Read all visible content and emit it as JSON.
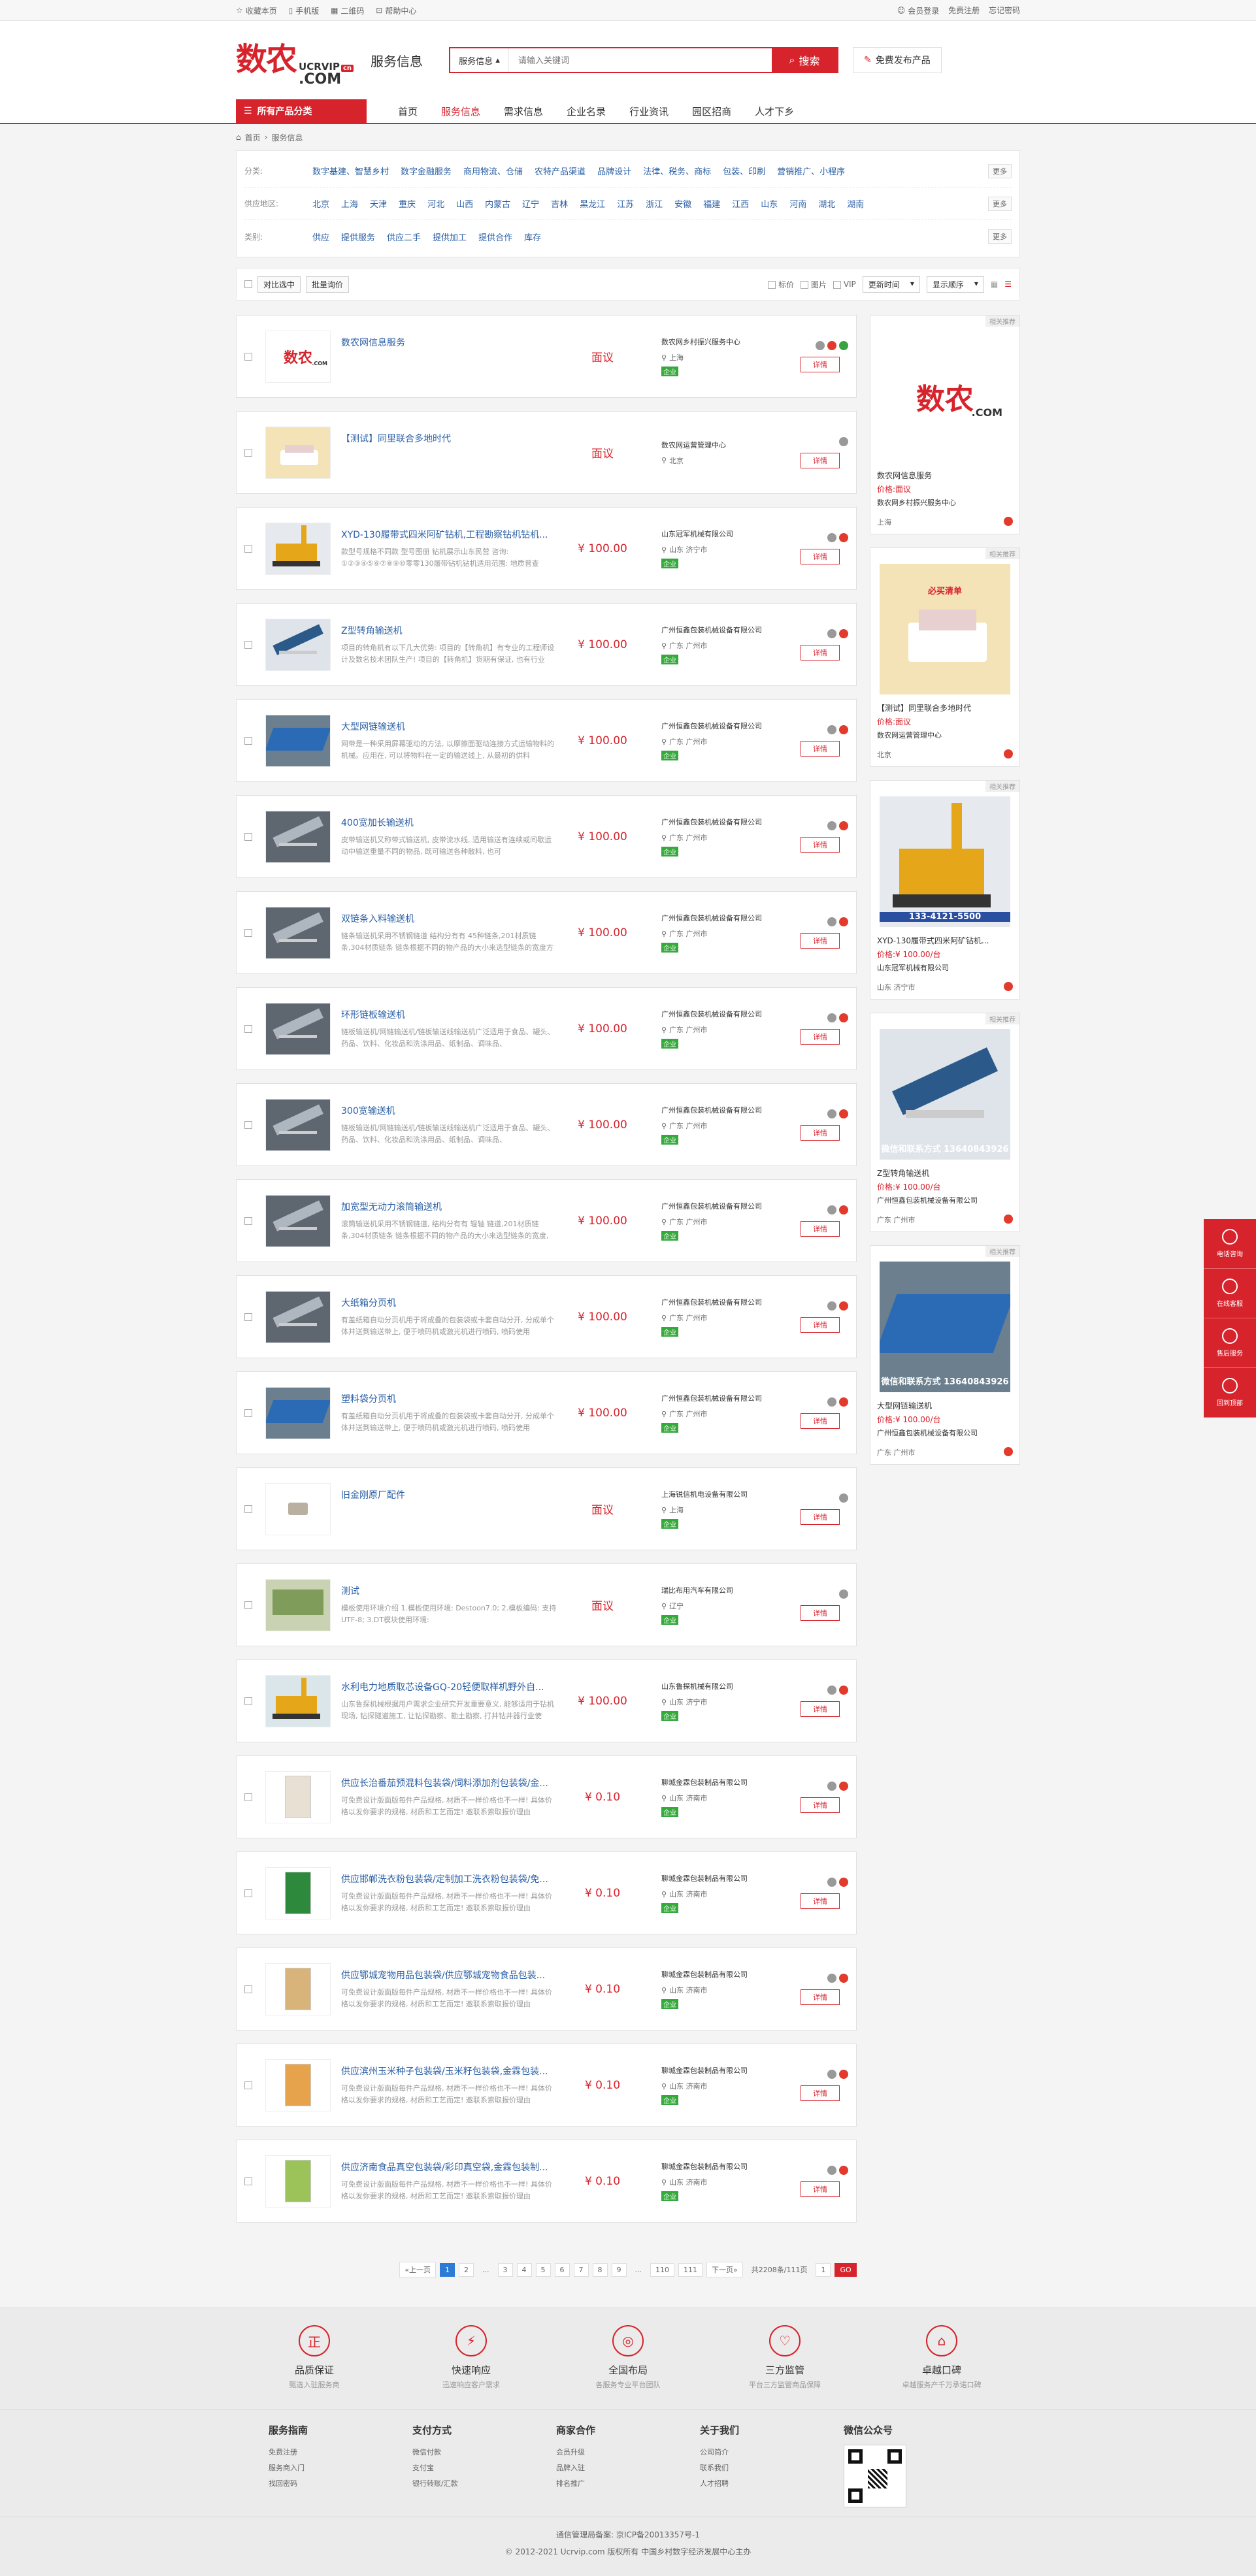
{
  "topbar": {
    "left": [
      "收藏本页",
      "手机版",
      "二维码",
      "帮助中心"
    ],
    "right": [
      "会员登录",
      "免费注册",
      "忘记密码"
    ]
  },
  "header": {
    "logo_cn": "数农",
    "logo_en1": "UCRVIP",
    "logo_en2": ".COM",
    "logo_badge": "cn",
    "title": "服务信息",
    "search_type": "服务信息",
    "search_placeholder": "请输入关键词",
    "search_btn": "搜索",
    "publish_btn": "免费发布产品"
  },
  "nav": {
    "category": "所有产品分类",
    "items": [
      "首页",
      "服务信息",
      "需求信息",
      "企业名录",
      "行业资讯",
      "园区招商",
      "人才下乡"
    ],
    "active": 1
  },
  "breadcrumb": [
    "首页",
    "服务信息"
  ],
  "filters": [
    {
      "label": "分类:",
      "opts": [
        "数字基建、智慧乡村",
        "数字金融服务",
        "商用物流、仓储",
        "农特产品渠道",
        "品牌设计",
        "法律、税务、商标",
        "包装、印刷",
        "营销推广、小程序"
      ],
      "more": "更多"
    },
    {
      "label": "供应地区:",
      "opts": [
        "北京",
        "上海",
        "天津",
        "重庆",
        "河北",
        "山西",
        "内蒙古",
        "辽宁",
        "吉林",
        "黑龙江",
        "江苏",
        "浙江",
        "安徽",
        "福建",
        "江西",
        "山东",
        "河南",
        "湖北",
        "湖南"
      ],
      "more": "更多"
    },
    {
      "label": "类别:",
      "opts": [
        "供应",
        "提供服务",
        "供应二手",
        "提供加工",
        "提供合作",
        "库存"
      ],
      "more": "更多"
    }
  ],
  "toolbar": {
    "compare": "对比选中",
    "inquiry": "批量询价",
    "opt1": "标价",
    "opt2": "图片",
    "opt3": "VIP",
    "sort": "更新时间",
    "display": "显示顺序"
  },
  "items": [
    {
      "title": "数农网信息服务",
      "desc": "",
      "price": "面议",
      "company": "数农网乡村振兴服务中心",
      "loc": "上海",
      "tag": "企业",
      "img": "logo"
    },
    {
      "title": "【测试】同里联合多地时代",
      "desc": "",
      "price": "面议",
      "company": "数农网运营管理中心",
      "loc": "北京",
      "tag": "",
      "img": "bed"
    },
    {
      "title": "XYD-130履带式四米阿矿钻机,工程勘察钻机钻机...",
      "desc": "款型号规格不同款 型号图册 钻机展示山东民营 咨询: ①②③④⑤⑥⑦⑧⑨⑩零零130履带钻机钻机适用范围: 地质普查",
      "price": "¥ 100.00",
      "company": "山东冠军机械有限公司",
      "loc": "山东 济宁市",
      "tag": "企业",
      "img": "drill"
    },
    {
      "title": "Z型转角输送机",
      "desc": "项目的转角机有以下几大优势: 项目的【转角机】有专业的工程师设计及数名技术团队生产! 项目的【转角机】货期有保证, 也有行业",
      "price": "¥ 100.00",
      "company": "广州恒鑫包装机械设备有限公司",
      "loc": "广东 广州市",
      "tag": "企业",
      "img": "conv"
    },
    {
      "title": "大型网链输送机",
      "desc": "网带是一种采用屏幕驱动的方法, 以摩擦面驱动连接方式运输物料的机械。应用在, 可以将物料在一定的输送线上, 从最初的供料",
      "price": "¥ 100.00",
      "company": "广州恒鑫包装机械设备有限公司",
      "loc": "广东 广州市",
      "tag": "企业",
      "img": "blue"
    },
    {
      "title": "400宽加长输送机",
      "desc": "皮带输送机又称带式输送机, 皮带流水线, 适用输送有连续或间歇运动中输送重量不同的物品, 既可输送各种散料, 也可",
      "price": "¥ 100.00",
      "company": "广州恒鑫包装机械设备有限公司",
      "loc": "广东 广州市",
      "tag": "企业",
      "img": "conv2"
    },
    {
      "title": "双链条入料输送机",
      "desc": "链条输送机采用不锈钢链道 结构分有有 45种链条,201材质链条,304材质链条 链条根据不同的物产品的大小来选型链条的宽度方",
      "price": "¥ 100.00",
      "company": "广州恒鑫包装机械设备有限公司",
      "loc": "广东 广州市",
      "tag": "企业",
      "img": "conv3"
    },
    {
      "title": "环形链板输送机",
      "desc": "链板输送机/网链输送机/链板输送线输送机广泛适用于食品、罐头、药品、饮料、化妆品和洗涤用品、纸制品、调味品、",
      "price": "¥ 100.00",
      "company": "广州恒鑫包装机械设备有限公司",
      "loc": "广东 广州市",
      "tag": "企业",
      "img": "conv2"
    },
    {
      "title": "300宽输送机",
      "desc": "链板输送机/网链输送机/链板输送线输送机广泛适用于食品、罐头、药品、饮料、化妆品和洗涤用品、纸制品、调味品、",
      "price": "¥ 100.00",
      "company": "广州恒鑫包装机械设备有限公司",
      "loc": "广东 广州市",
      "tag": "企业",
      "img": "conv3"
    },
    {
      "title": "加宽型无动力滚筒输送机",
      "desc": "滚筒输送机采用不锈钢链道, 结构分有有 辊轴 链道,201材质链条,304材质链条 链条根据不同的物产品的大小来选型链条的宽度, 选型",
      "price": "¥ 100.00",
      "company": "广州恒鑫包装机械设备有限公司",
      "loc": "广东 广州市",
      "tag": "企业",
      "img": "conv2"
    },
    {
      "title": "大纸箱分页机",
      "desc": "有盖纸箱自动分页机用于将成叠的包装袋或卡套自动分开, 分成单个体并送到输送带上, 便于喷码机或激光机进行喷码, 喷码使用",
      "price": "¥ 100.00",
      "company": "广州恒鑫包装机械设备有限公司",
      "loc": "广东 广州市",
      "tag": "企业",
      "img": "conv3"
    },
    {
      "title": "塑料袋分页机",
      "desc": "有盖纸箱自动分页机用于将成叠的包装袋或卡套自动分开, 分成单个体并送到输送带上, 便于喷码机或激光机进行喷码, 喷码使用",
      "price": "¥ 100.00",
      "company": "广州恒鑫包装机械设备有限公司",
      "loc": "广东 广州市",
      "tag": "企业",
      "img": "blue"
    },
    {
      "title": "旧金刚原厂配件",
      "desc": "",
      "price": "面议",
      "company": "上海锐信机电设备有限公司",
      "loc": "上海",
      "tag": "企业",
      "img": "part"
    },
    {
      "title": "测试",
      "desc": "模板使用环境介绍 1.模板使用环境: Destoon7.0; 2.模板编码: 支持UTF-8; 3.DT模块使用环境:",
      "price": "面议",
      "company": "瑞比布用汽车有限公司",
      "loc": "辽宁",
      "tag": "企业",
      "img": "room"
    },
    {
      "title": "水利电力地质取芯设备GQ-20轻便取样机野外自...",
      "desc": "山东鲁探机械根据用户需求企业研究开发重要意义, 能够适用于钻机现场, 钻探隧道施工, 让钻探勘察、勘土勘察, 打井钻井器行业使",
      "price": "¥ 100.00",
      "company": "山东鲁探机械有限公司",
      "loc": "山东 济宁市",
      "tag": "企业",
      "img": "drill2"
    },
    {
      "title": "供应长治番茄预混料包装袋/饲料添加剂包装袋/金...",
      "desc": "可免费设计版面版每件产品规格, 材质不一样价格也不一样! 具体价格以发你要求的规格, 材质和工艺而定! 邀联系索取报价理由",
      "price": "¥ 0.10",
      "company": "聊城金霖包装制品有限公司",
      "loc": "山东 济南市",
      "tag": "企业",
      "img": "bag"
    },
    {
      "title": "供应邯郸洗衣粉包装袋/定制加工洗衣粉包装袋/免...",
      "desc": "可免费设计版面版每件产品规格, 材质不一样价格也不一样! 具体价格以发你要求的规格, 材质和工艺而定! 邀联系索取报价理由",
      "price": "¥ 0.10",
      "company": "聊城金霖包装制品有限公司",
      "loc": "山东 济南市",
      "tag": "企业",
      "img": "bag2"
    },
    {
      "title": "供应鄂城宠物用品包装袋/供应鄂城宠物食品包装...",
      "desc": "可免费设计版面版每件产品规格, 材质不一样价格也不一样! 具体价格以发你要求的规格, 材质和工艺而定! 邀联系索取报价理由",
      "price": "¥ 0.10",
      "company": "聊城金霖包装制品有限公司",
      "loc": "山东 济南市",
      "tag": "企业",
      "img": "bag3"
    },
    {
      "title": "供应滨州玉米种子包装袋/玉米籽包装袋,金霖包装...",
      "desc": "可免费设计版面版每件产品规格, 材质不一样价格也不一样! 具体价格以发你要求的规格, 材质和工艺而定! 邀联系索取报价理由",
      "price": "¥ 0.10",
      "company": "聊城金霖包装制品有限公司",
      "loc": "山东 济南市",
      "tag": "企业",
      "img": "bag4"
    },
    {
      "title": "供应济南食品真空包装袋/彩印真空袋,金霖包装制...",
      "desc": "可免费设计版面版每件产品规格, 材质不一样价格也不一样! 具体价格以发你要求的规格, 材质和工艺而定! 邀联系索取报价理由",
      "price": "¥ 0.10",
      "company": "聊城金霖包装制品有限公司",
      "loc": "山东 济南市",
      "tag": "企业",
      "img": "bag5"
    }
  ],
  "side": {
    "flag": "相关推荐",
    "cards": [
      {
        "name": "数农网信息服务",
        "price_label": "价格:",
        "price": "面议",
        "company": "数农网乡村振兴服务中心",
        "loc": "上海",
        "img": "logo"
      },
      {
        "name": "【测试】同里联合多地时代",
        "price_label": "价格:",
        "price": "面议",
        "company": "数农网运营管理中心",
        "loc": "北京",
        "img": "bed",
        "imgtext": "必买清单"
      },
      {
        "name": "XYD-130履带式四米阿矿钻机...",
        "price_label": "价格:",
        "price": "¥ 100.00/台",
        "company": "山东冠军机械有限公司",
        "loc": "山东 济宁市",
        "img": "drill",
        "imgtext": "133-4121-5500"
      },
      {
        "name": "Z型转角输送机",
        "price_label": "价格:",
        "price": "¥ 100.00/台",
        "company": "广州恒鑫包装机械设备有限公司",
        "loc": "广东 广州市",
        "img": "conv",
        "imgtext": "微信和联系方式 13640843926"
      },
      {
        "name": "大型网链输送机",
        "price_label": "价格:",
        "price": "¥ 100.00/台",
        "company": "广州恒鑫包装机械设备有限公司",
        "loc": "广东 广州市",
        "img": "blue",
        "imgtext": "微信和联系方式 13640843926"
      }
    ]
  },
  "detail_btn": "详情",
  "pager": {
    "prev": "«上一页",
    "pages": [
      "1",
      "2",
      "...",
      "3",
      "4",
      "5",
      "6",
      "7",
      "8",
      "9",
      "...",
      "110",
      "111"
    ],
    "next": "下一页»",
    "total": "共2208条/111页",
    "jump": "1",
    "go": "GO"
  },
  "features": [
    {
      "icon": "正",
      "title": "品质保证",
      "sub": "甄选入驻服务商"
    },
    {
      "icon": "⚡",
      "title": "快速响应",
      "sub": "迅速响应客户需求"
    },
    {
      "icon": "◎",
      "title": "全国布局",
      "sub": "各服务专业平台团队"
    },
    {
      "icon": "♡",
      "title": "三方监管",
      "sub": "平台三方监管商品保障"
    },
    {
      "icon": "⌂",
      "title": "卓越口碑",
      "sub": "卓越服务产千万承诺口碑"
    }
  ],
  "footer_links": [
    {
      "title": "服务指南",
      "items": [
        "免费注册",
        "服务商入门",
        "找回密码"
      ]
    },
    {
      "title": "支付方式",
      "items": [
        "微信付款",
        "支付宝",
        "银行转账/汇款"
      ]
    },
    {
      "title": "商家合作",
      "items": [
        "会员升级",
        "品牌入驻",
        "排名推广"
      ]
    },
    {
      "title": "关于我们",
      "items": [
        "公司简介",
        "联系我们",
        "人才招聘"
      ]
    }
  ],
  "wechat": "微信公众号",
  "bottom": {
    "icp": "通信管理局备案:   京ICP备20013357号-1",
    "copy": "© 2012-2021 Ucrvip.com 版权所有 中国乡村数字经济发展中心主办"
  },
  "float": [
    "电话咨询",
    "在线客服",
    "售后服务",
    "回到顶部"
  ]
}
